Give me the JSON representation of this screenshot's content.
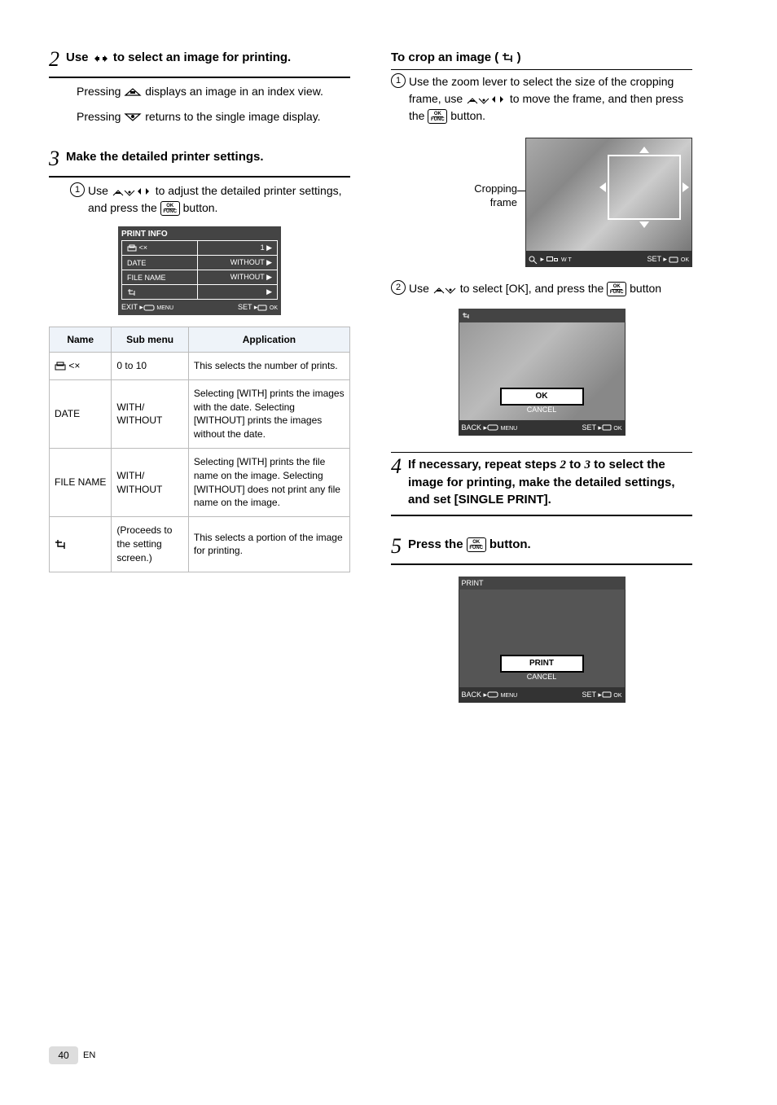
{
  "left": {
    "step2": {
      "num": "2",
      "title_a": "Use ",
      "title_b": " to select an image for printing.",
      "note_a": "Pressing ",
      "note_b": " displays an image in an index view.",
      "note_c": "Pressing ",
      "note_d": " returns to the single image display."
    },
    "step3": {
      "num": "3",
      "text_a": "Make the detailed printer settings.",
      "sub1_a": "Use ",
      "sub1_b": " to adjust the detailed printer settings, and press the ",
      "sub1_c": " button."
    },
    "print_info": {
      "title": "PRINT INFO",
      "row1_name_icon": "print",
      "row1_alt": "<×",
      "row1_val": "1",
      "row2_name": "DATE",
      "row2_val": "WITHOUT",
      "row3_name": "FILE NAME",
      "row3_val": "WITHOUT",
      "row4_name_icon": "crop",
      "exit": "EXIT",
      "menu": "MENU",
      "set": "SET",
      "ok": "OK"
    },
    "table": {
      "h1": "Name",
      "h2": "Sub menu",
      "h3": "Application",
      "r1_icon": "print",
      "r1_alt": "<×",
      "r1_sub": "0 to 10",
      "r1_app": "This selects the number of prints.",
      "r2_name": "DATE",
      "r2_sub": "WITH/ WITHOUT",
      "r2_app": "Selecting [WITH] prints the images with the date. Selecting [WITHOUT] prints the images without the date.",
      "r3_name": "FILE NAME",
      "r3_sub": "WITH/ WITHOUT",
      "r3_app": "Selecting [WITH] prints the file name on the image. Selecting [WITHOUT] does not print any file name on the image.",
      "r4_icon": "crop",
      "r4_sub": "(Proceeds to the setting screen.)",
      "r4_app": "This selects a portion of the image for printing."
    }
  },
  "right": {
    "crop_title_a": "To crop an image (",
    "crop_title_b": ")",
    "sub1_a": "Use the zoom lever to select the size of the cropping frame, use ",
    "sub1_b": " to move the frame, and then press the ",
    "sub1_c": " button.",
    "crop_label": "Cropping frame",
    "crop_footer_left": "W  T",
    "crop_footer_set": "SET",
    "crop_footer_ok": "OK",
    "sub2_a": "Use ",
    "sub2_b": " to select [OK], and press the ",
    "sub2_c": " button",
    "preview_header_icon": "crop",
    "preview_ok": "OK",
    "preview_cancel": "CANCEL",
    "preview_back": "BACK",
    "preview_menu": "MENU",
    "preview_set": "SET",
    "step4": {
      "num": "4",
      "text_a": "If necessary, repeat steps ",
      "text_b": " to ",
      "text_c": " to select the image for printing, make the detailed settings, and set [SINGLE PRINT].",
      "step_ref_1": "2",
      "step_ref_2": "3"
    },
    "step5": {
      "num": "5",
      "text_a": "Press the ",
      "text_b": " button."
    },
    "print_panel": {
      "title": "PRINT",
      "opt1": "PRINT",
      "opt2": "CANCEL",
      "back": "BACK",
      "menu": "MENU",
      "set": "SET",
      "ok": "OK"
    }
  },
  "page_number": "40",
  "lang": "EN"
}
